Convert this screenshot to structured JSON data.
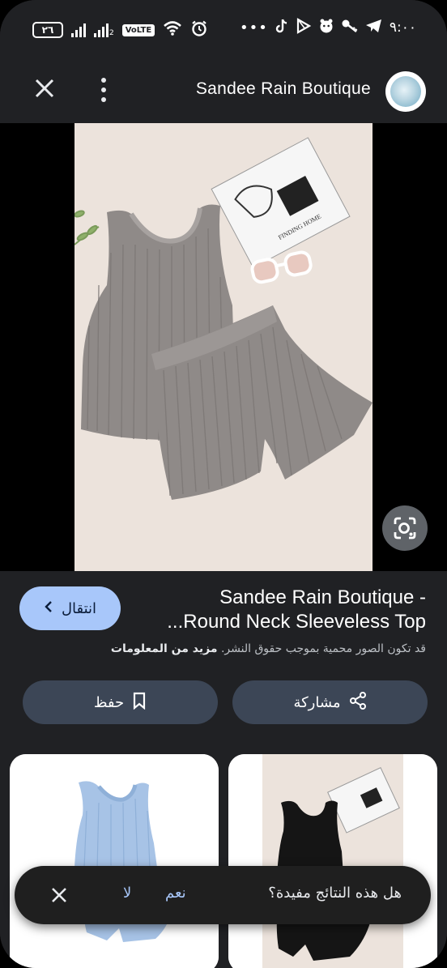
{
  "status_bar": {
    "battery": "٢٦",
    "volte": "VoLTE",
    "signal_sub": "2",
    "time": "٩:٠٠",
    "right_icons": [
      "more-dots",
      "tiktok",
      "play",
      "face",
      "key",
      "telegram"
    ]
  },
  "header": {
    "title": "Sandee Rain Boutique",
    "close_icon": "close-icon",
    "more_icon": "more-vert-icon"
  },
  "result": {
    "visit_label": "انتقال",
    "title_line1": "Sandee Rain Boutique -",
    "title_line2": "Round Neck Sleeveless Top...",
    "copyright_text": "قد تكون الصور محمية بموجب حقوق النشر.",
    "more_info_link": "مزيد من المعلومات",
    "save_label": "حفظ",
    "share_label": "مشاركة"
  },
  "feedback": {
    "question": "هل هذه النتائج مفيدة؟",
    "yes_label": "نعم",
    "no_label": "لا"
  },
  "colors": {
    "background": "#202124",
    "accent_button": "#a8c7fa",
    "action_button": "#3c4656",
    "link": "#a8c7fa"
  }
}
